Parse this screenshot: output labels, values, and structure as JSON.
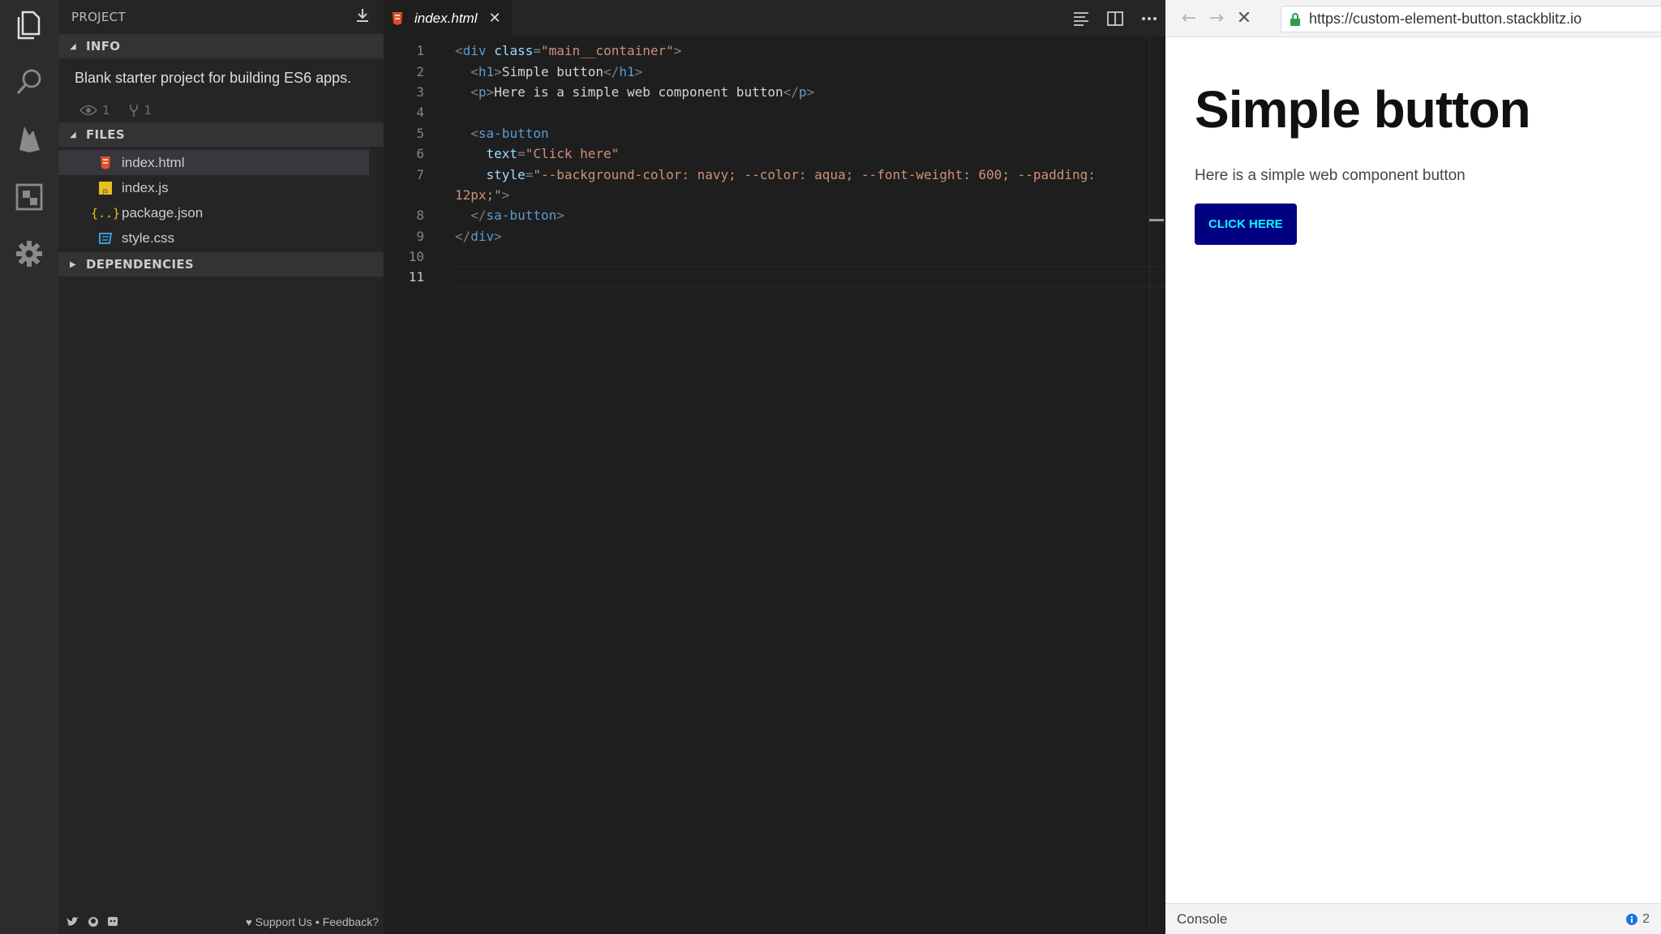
{
  "sidebar": {
    "title": "PROJECT",
    "info_section": "INFO",
    "description": "Blank starter project for building ES6 apps.",
    "views": "1",
    "forks": "1",
    "files_section": "FILES",
    "files": [
      {
        "name": "index.html",
        "icon": "html-file-icon"
      },
      {
        "name": "index.js",
        "icon": "js-file-icon"
      },
      {
        "name": "package.json",
        "icon": "json-file-icon"
      },
      {
        "name": "style.css",
        "icon": "css-file-icon"
      }
    ],
    "dependencies_section": "DEPENDENCIES",
    "footer": {
      "support": "Support Us",
      "separator": "•",
      "feedback": "Feedback?"
    }
  },
  "editor": {
    "tab": {
      "label": "index.html",
      "close": "✕"
    },
    "line_numbers": [
      "1",
      "2",
      "3",
      "4",
      "5",
      "6",
      "7",
      "",
      "8",
      "9",
      "10",
      "11"
    ],
    "code": {
      "l1_tag": "div",
      "l1_attr": "class",
      "l1_val": "\"main__container\"",
      "l2_tag": "h1",
      "l2_text": "Simple button",
      "l3_tag": "p",
      "l3_text": "Here is a simple web component button",
      "l5_tag": "sa-button",
      "l6_attr": "text",
      "l6_val": "\"Click here\"",
      "l7_attr": "style",
      "l7_val": "\"--background-color: navy; --color: aqua; --font-weight: 600; --padding:",
      "l7b_val": "12px;\"",
      "l8_tag": "sa-button",
      "l9_tag": "div"
    }
  },
  "browser": {
    "url": "https://custom-element-button.stackblitz.io",
    "heading": "Simple button",
    "paragraph": "Here is a simple web component button",
    "button": "Click here",
    "console_label": "Console",
    "info_count": "2"
  }
}
